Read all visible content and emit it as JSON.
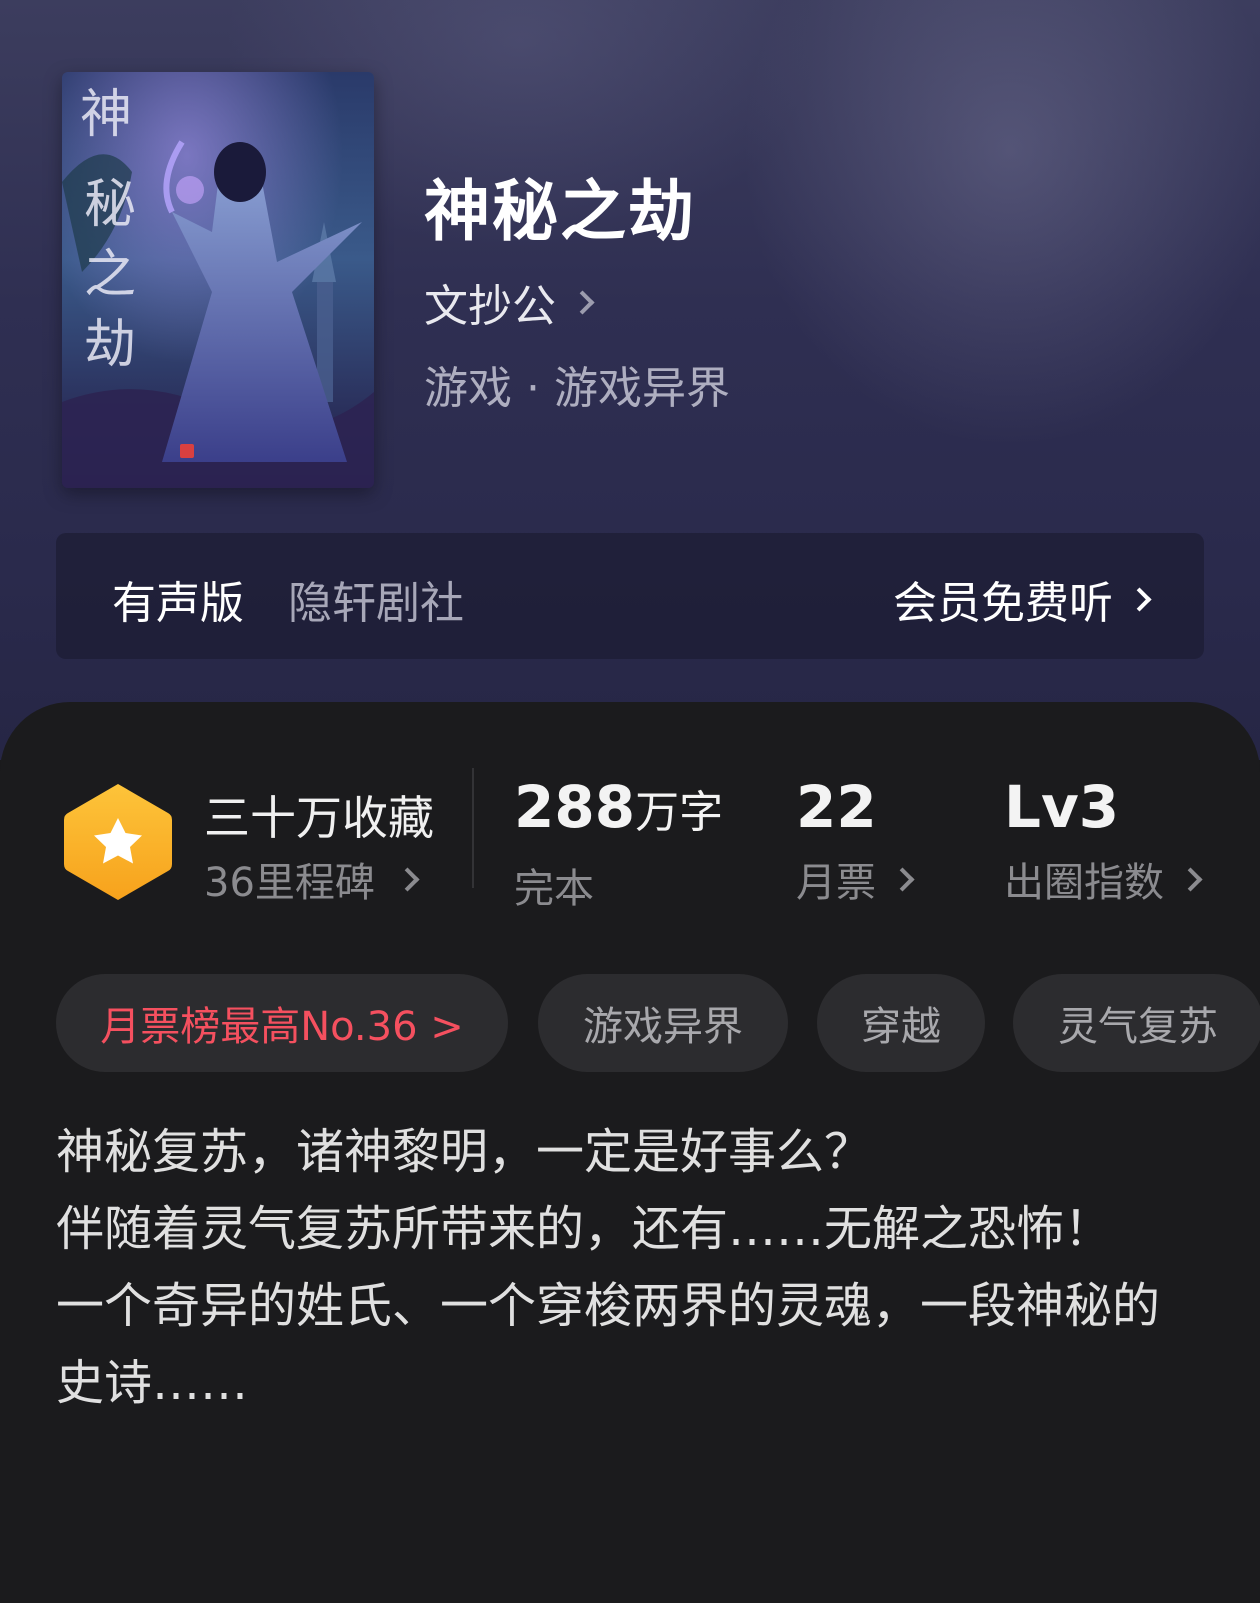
{
  "book": {
    "cover_title": "神秘之劫",
    "title": "神秘之劫",
    "author": "文抄公",
    "genre": "游戏 · 游戏异界"
  },
  "audio": {
    "label": "有声版",
    "studio": "隐轩剧社",
    "link": "会员免费听"
  },
  "stats": {
    "collection_title": "三十万收藏",
    "milestone": "36里程碑",
    "word_count": "288",
    "word_unit": "万字",
    "status": "完本",
    "monthly_votes": "22",
    "monthly_votes_label": "月票",
    "level": "Lv3",
    "level_label": "出圈指数"
  },
  "tags": [
    "月票榜最高No.36 >",
    "游戏异界",
    "穿越",
    "灵气复苏"
  ],
  "description": [
    "神秘复苏，诸神黎明，一定是好事么？",
    "伴随着灵气复苏所带来的，还有……无解之恐怖！",
    "一个奇异的姓氏、一个穿梭两界的灵魂，一段神秘的史诗……"
  ],
  "colors": {
    "accent_red": "#f5505f",
    "badge_orange": "#fbb82c"
  }
}
